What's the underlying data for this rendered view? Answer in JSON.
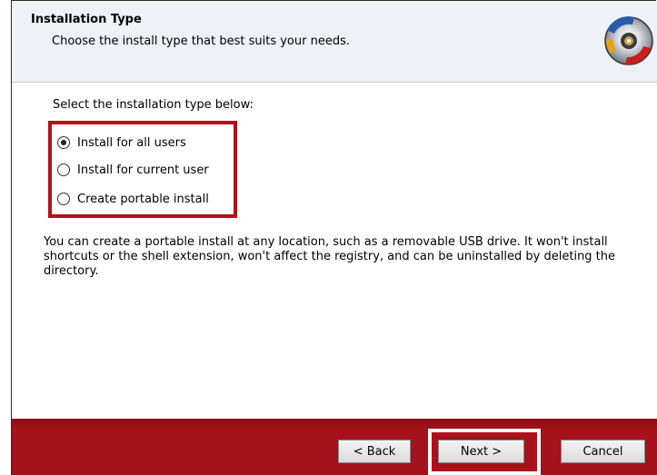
{
  "header": {
    "title": "Installation Type",
    "subtitle": "Choose the install type that best suits your needs.",
    "icon": "installer-disc-icon"
  },
  "body": {
    "prompt": "Select the installation type below:",
    "options": [
      {
        "label": "Install for all users",
        "checked": true
      },
      {
        "label": "Install for current user",
        "checked": false
      },
      {
        "label": "Create portable install",
        "checked": false
      }
    ],
    "description": "You can create a portable install at any location, such as a removable USB drive.  It won't install shortcuts or the shell extension, won't affect the registry, and can be uninstalled by deleting the directory."
  },
  "footer": {
    "back_label": "< Back",
    "next_label": "Next >",
    "cancel_label": "Cancel"
  },
  "colors": {
    "highlight": "#b0121b",
    "footer_bg": "#a5121b",
    "header_bg": "#eef1f6"
  }
}
